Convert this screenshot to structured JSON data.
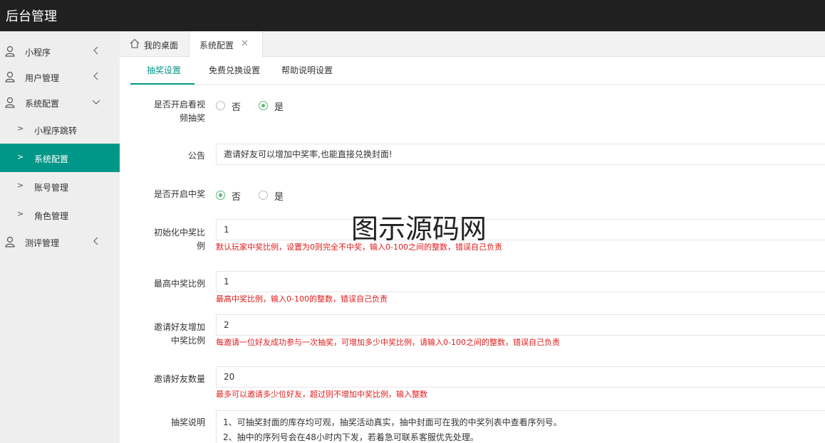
{
  "app": {
    "title": "后台管理"
  },
  "sidebar": {
    "items": [
      {
        "label": "小程序"
      },
      {
        "label": "用户管理"
      },
      {
        "label": "系统配置"
      },
      {
        "label": "小程序跳转"
      },
      {
        "label": "系统配置"
      },
      {
        "label": "账号管理"
      },
      {
        "label": "角色管理"
      },
      {
        "label": "测评管理"
      }
    ]
  },
  "tabs": [
    {
      "label": "我的桌面"
    },
    {
      "label": "系统配置"
    }
  ],
  "subtabs": [
    {
      "label": "抽奖设置"
    },
    {
      "label": "免费兑换设置"
    },
    {
      "label": "帮助说明设置"
    }
  ],
  "form": {
    "video_lottery": {
      "label_line1": "是否开启看视",
      "label_line2": "频抽奖",
      "option_no": "否",
      "option_yes": "是",
      "selected": "是"
    },
    "notice": {
      "label": "公告",
      "value": "邀请好友可以增加中奖率,也能直接兑换封面!"
    },
    "open_win": {
      "label": "是否开启中奖",
      "option_no": "否",
      "option_yes": "是",
      "selected": "否"
    },
    "init_ratio": {
      "label_line1": "初始化中奖比",
      "label_line2": "例",
      "value": "1",
      "hint": "默认玩家中奖比例，设置为0则完全不中奖，输入0-100之间的整数，错误自己负责"
    },
    "max_ratio": {
      "label": "最高中奖比例",
      "value": "1",
      "hint": "最高中奖比例，输入0-100的整数，错误自己负责"
    },
    "invite_add": {
      "label_line1": "邀请好友增加",
      "label_line2": "中奖比例",
      "value": "2",
      "hint": "每邀请一位好友成功参与一次抽奖，可增加多少中奖比例，请输入0-100之间的整数，错误自己负责"
    },
    "invite_count": {
      "label": "邀请好友数量",
      "value": "20",
      "hint": "最多可以邀请多少位好友，超过则不增加中奖比例，输入整数"
    },
    "lottery_desc": {
      "label": "抽奖说明",
      "line1": "1、可抽奖封面的库存均可观，抽奖活动真实，抽中封面可在我的中奖列表中查看序列号。",
      "line2": "2、抽中的序列号会在48小时内下发，若着急可联系客服优先处理。"
    }
  },
  "watermark": {
    "text": "图示源码网"
  },
  "colors": {
    "accent": "#009688",
    "topbar": "#202020",
    "radio": "#5fb878",
    "hint": "#e01b1b"
  }
}
